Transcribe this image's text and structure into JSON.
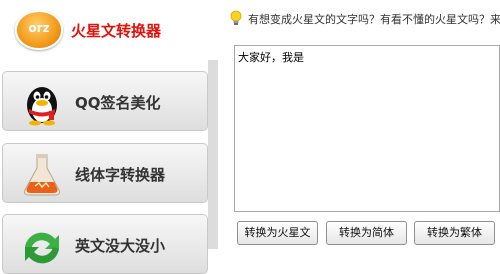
{
  "sidebar": {
    "items": [
      {
        "label": "火星文转换器",
        "icon": "orz-badge-icon",
        "badge_text": "orz",
        "active": true
      },
      {
        "label": "QQ签名美化",
        "icon": "qq-penguin-icon"
      },
      {
        "label": "线体字转换器",
        "icon": "flask-icon"
      },
      {
        "label": "英文没大没小",
        "icon": "green-arrows-icon"
      }
    ]
  },
  "tip": {
    "icon": "lightbulb-icon",
    "text": "有想变成火星文的文字吗？有看不懂的火星文吗？来"
  },
  "editor": {
    "value": "大家好，我是"
  },
  "buttons": {
    "to_martian": "转换为火星文",
    "to_simplified": "转换为简体",
    "to_traditional": "转换为繁体"
  },
  "colors": {
    "active_label": "#e3120b",
    "badge": "#f39a1c"
  }
}
